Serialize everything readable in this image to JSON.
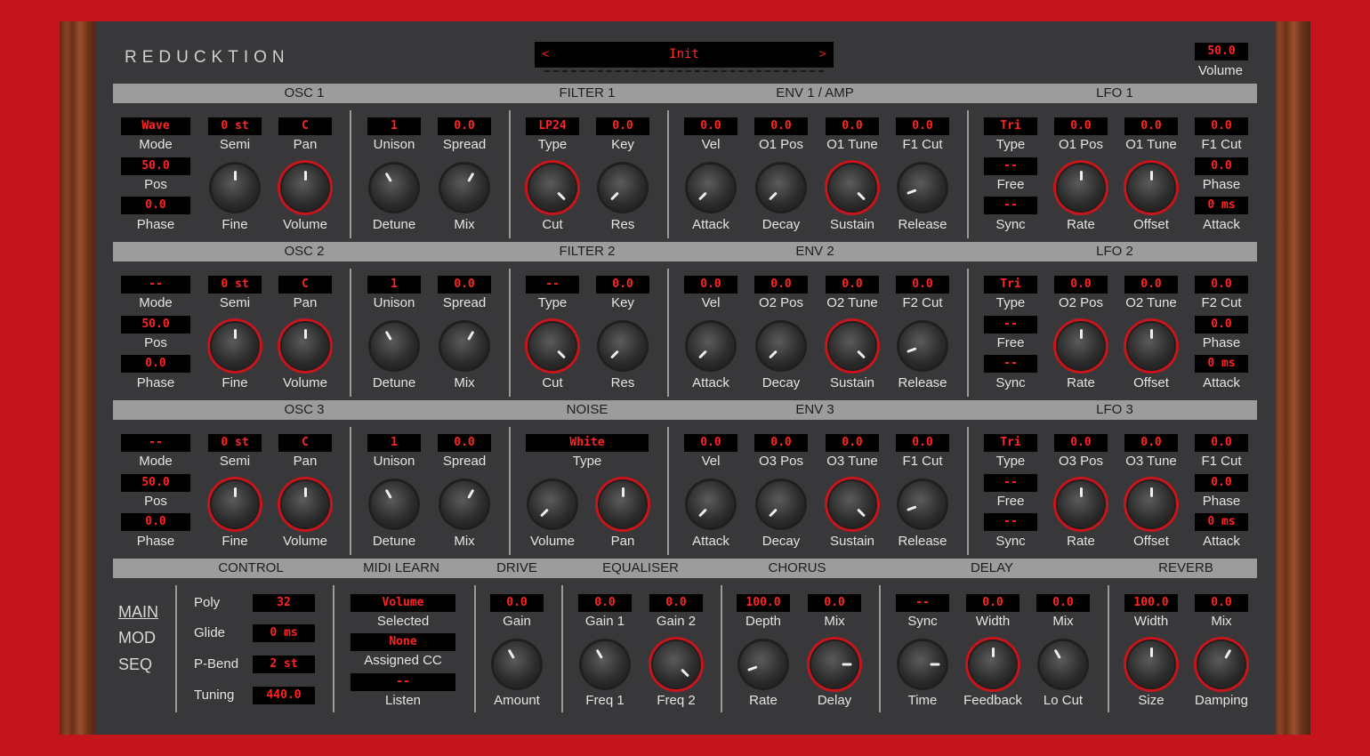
{
  "app": {
    "title": "REDUCKTION"
  },
  "preset": {
    "name": "Init",
    "prev": "<",
    "next": ">"
  },
  "master": {
    "value": "50.0",
    "label": "Volume"
  },
  "sections": {
    "osc1": "OSC 1",
    "filter1": "FILTER 1",
    "env1": "ENV 1 / AMP",
    "lfo1": "LFO 1",
    "osc2": "OSC 2",
    "filter2": "FILTER 2",
    "env2": "ENV 2",
    "lfo2": "LFO 2",
    "osc3": "OSC 3",
    "noise": "NOISE",
    "env3": "ENV 3",
    "lfo3": "LFO 3",
    "control": "CONTROL",
    "midi": "MIDI LEARN",
    "drive": "DRIVE",
    "eq": "EQUALISER",
    "chorus": "CHORUS",
    "delay": "DELAY",
    "reverb": "REVERB"
  },
  "osc1": {
    "mode": "Wave",
    "semi": "0 st",
    "pan": "C",
    "pos": "50.0",
    "phase": "0.0",
    "unison": "1",
    "spread": "0.0",
    "labels": {
      "mode": "Mode",
      "semi": "Semi",
      "pan": "Pan",
      "pos": "Pos",
      "phase": "Phase",
      "fine": "Fine",
      "volume": "Volume",
      "unison": "Unison",
      "spread": "Spread",
      "detune": "Detune",
      "mix": "Mix"
    }
  },
  "osc2": {
    "mode": "--",
    "semi": "0 st",
    "pan": "C",
    "pos": "50.0",
    "phase": "0.0",
    "unison": "1",
    "spread": "0.0",
    "labels": {
      "mode": "Mode",
      "semi": "Semi",
      "pan": "Pan",
      "pos": "Pos",
      "phase": "Phase",
      "fine": "Fine",
      "volume": "Volume",
      "unison": "Unison",
      "spread": "Spread",
      "detune": "Detune",
      "mix": "Mix"
    }
  },
  "osc3": {
    "mode": "--",
    "semi": "0 st",
    "pan": "C",
    "pos": "50.0",
    "phase": "0.0",
    "unison": "1",
    "spread": "0.0",
    "labels": {
      "mode": "Mode",
      "semi": "Semi",
      "pan": "Pan",
      "pos": "Pos",
      "phase": "Phase",
      "fine": "Fine",
      "volume": "Volume",
      "unison": "Unison",
      "spread": "Spread",
      "detune": "Detune",
      "mix": "Mix"
    }
  },
  "filter1": {
    "type": "LP24",
    "key": "0.0",
    "labels": {
      "type": "Type",
      "key": "Key",
      "cut": "Cut",
      "res": "Res"
    }
  },
  "filter2": {
    "type": "--",
    "key": "0.0",
    "labels": {
      "type": "Type",
      "key": "Key",
      "cut": "Cut",
      "res": "Res"
    }
  },
  "noise": {
    "type": "White",
    "labels": {
      "type": "Type",
      "volume": "Volume",
      "pan": "Pan"
    }
  },
  "env1": {
    "vel": "0.0",
    "p1": "0.0",
    "p2": "0.0",
    "p3": "0.0",
    "labels": {
      "vel": "Vel",
      "p1": "O1 Pos",
      "p2": "O1 Tune",
      "p3": "F1 Cut",
      "attack": "Attack",
      "decay": "Decay",
      "sustain": "Sustain",
      "release": "Release"
    }
  },
  "env2": {
    "vel": "0.0",
    "p1": "0.0",
    "p2": "0.0",
    "p3": "0.0",
    "labels": {
      "vel": "Vel",
      "p1": "O2 Pos",
      "p2": "O2 Tune",
      "p3": "F2 Cut",
      "attack": "Attack",
      "decay": "Decay",
      "sustain": "Sustain",
      "release": "Release"
    }
  },
  "env3": {
    "vel": "0.0",
    "p1": "0.0",
    "p2": "0.0",
    "p3": "0.0",
    "labels": {
      "vel": "Vel",
      "p1": "O3 Pos",
      "p2": "O3 Tune",
      "p3": "F1 Cut",
      "attack": "Attack",
      "decay": "Decay",
      "sustain": "Sustain",
      "release": "Release"
    }
  },
  "lfo1": {
    "type": "Tri",
    "p1": "0.0",
    "p2": "0.0",
    "p3": "0.0",
    "free": "--",
    "phase": "0.0",
    "sync": "--",
    "attack": "0 ms",
    "labels": {
      "type": "Type",
      "p1": "O1 Pos",
      "p2": "O1 Tune",
      "p3": "F1 Cut",
      "free": "Free",
      "phase": "Phase",
      "sync": "Sync",
      "rate": "Rate",
      "offset": "Offset",
      "attack": "Attack"
    }
  },
  "lfo2": {
    "type": "Tri",
    "p1": "0.0",
    "p2": "0.0",
    "p3": "0.0",
    "free": "--",
    "phase": "0.0",
    "sync": "--",
    "attack": "0 ms",
    "labels": {
      "type": "Type",
      "p1": "O2 Pos",
      "p2": "O2 Tune",
      "p3": "F2 Cut",
      "free": "Free",
      "phase": "Phase",
      "sync": "Sync",
      "rate": "Rate",
      "offset": "Offset",
      "attack": "Attack"
    }
  },
  "lfo3": {
    "type": "Tri",
    "p1": "0.0",
    "p2": "0.0",
    "p3": "0.0",
    "free": "--",
    "phase": "0.0",
    "sync": "--",
    "attack": "0 ms",
    "labels": {
      "type": "Type",
      "p1": "O3 Pos",
      "p2": "O3 Tune",
      "p3": "F1 Cut",
      "free": "Free",
      "phase": "Phase",
      "sync": "Sync",
      "rate": "Rate",
      "offset": "Offset",
      "attack": "Attack"
    }
  },
  "nav": {
    "main": "MAIN",
    "mod": "MOD",
    "seq": "SEQ"
  },
  "control": {
    "poly": "32",
    "glide": "0 ms",
    "pbend": "2 st",
    "tuning": "440.0",
    "labels": {
      "poly": "Poly",
      "glide": "Glide",
      "pbend": "P-Bend",
      "tuning": "Tuning"
    }
  },
  "midi": {
    "selected": "Volume",
    "assigned": "None",
    "listen": "--",
    "labels": {
      "selected": "Selected",
      "assigned": "Assigned CC",
      "listen": "Listen"
    }
  },
  "drive": {
    "gain": "0.0",
    "labels": {
      "gain": "Gain",
      "amount": "Amount"
    }
  },
  "eq": {
    "gain1": "0.0",
    "gain2": "0.0",
    "labels": {
      "gain1": "Gain 1",
      "gain2": "Gain 2",
      "freq1": "Freq 1",
      "freq2": "Freq 2"
    }
  },
  "chorus": {
    "depth": "100.0",
    "mix": "0.0",
    "labels": {
      "depth": "Depth",
      "mix": "Mix",
      "rate": "Rate",
      "delay": "Delay"
    }
  },
  "delay": {
    "sync": "--",
    "width": "0.0",
    "mix": "0.0",
    "labels": {
      "sync": "Sync",
      "width": "Width",
      "mix": "Mix",
      "time": "Time",
      "feedback": "Feedback",
      "locut": "Lo Cut"
    }
  },
  "reverb": {
    "width": "100.0",
    "mix": "0.0",
    "labels": {
      "width": "Width",
      "mix": "Mix",
      "size": "Size",
      "damping": "Damping"
    }
  }
}
